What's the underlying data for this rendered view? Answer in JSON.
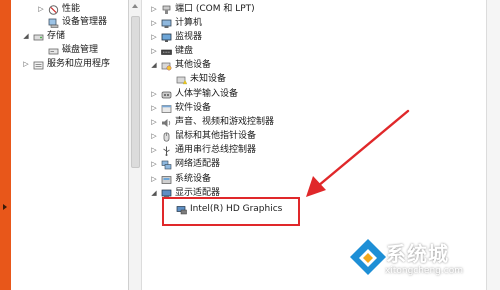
{
  "left_tree": {
    "items": [
      {
        "toggle": "▷",
        "icon": "performance-icon",
        "label": "性能"
      },
      {
        "toggle": "",
        "icon": "device-manager-icon",
        "label": "设备管理器"
      },
      {
        "toggle": "◢",
        "icon": "storage-icon",
        "label": "存储"
      },
      {
        "toggle": "",
        "icon": "disk-management-icon",
        "label": "磁盘管理"
      },
      {
        "toggle": "▷",
        "icon": "services-icon",
        "label": "服务和应用程序"
      }
    ]
  },
  "device_tree": {
    "items": [
      {
        "toggle": "▷",
        "icon": "port-icon",
        "label": "端口 (COM 和 LPT)"
      },
      {
        "toggle": "▷",
        "icon": "computer-icon",
        "label": "计算机"
      },
      {
        "toggle": "▷",
        "icon": "monitor-icon",
        "label": "监视器"
      },
      {
        "toggle": "▷",
        "icon": "keyboard-icon",
        "label": "键盘"
      },
      {
        "toggle": "◢",
        "icon": "other-devices-icon",
        "label": "其他设备"
      },
      {
        "toggle": "",
        "icon": "unknown-device-icon",
        "label": "未知设备"
      },
      {
        "toggle": "▷",
        "icon": "hid-icon",
        "label": "人体学输入设备"
      },
      {
        "toggle": "▷",
        "icon": "software-device-icon",
        "label": "软件设备"
      },
      {
        "toggle": "▷",
        "icon": "sound-icon",
        "label": "声音、视频和游戏控制器"
      },
      {
        "toggle": "▷",
        "icon": "mouse-icon",
        "label": "鼠标和其他指针设备"
      },
      {
        "toggle": "▷",
        "icon": "usb-icon",
        "label": "通用串行总线控制器"
      },
      {
        "toggle": "▷",
        "icon": "network-adapter-icon",
        "label": "网络适配器"
      },
      {
        "toggle": "▷",
        "icon": "system-device-icon",
        "label": "系统设备"
      },
      {
        "toggle": "◢",
        "icon": "display-adapter-icon",
        "label": "显示适配器"
      },
      {
        "toggle": "",
        "icon": "graphics-card-icon",
        "label": "Intel(R) HD Graphics"
      }
    ]
  },
  "watermark": {
    "name": "系统城",
    "url": "xitongcheng.com"
  },
  "colors": {
    "orange_strip": "#e8571a",
    "highlight_red": "#e0282a",
    "logo_blue": "#1e8fd6"
  }
}
